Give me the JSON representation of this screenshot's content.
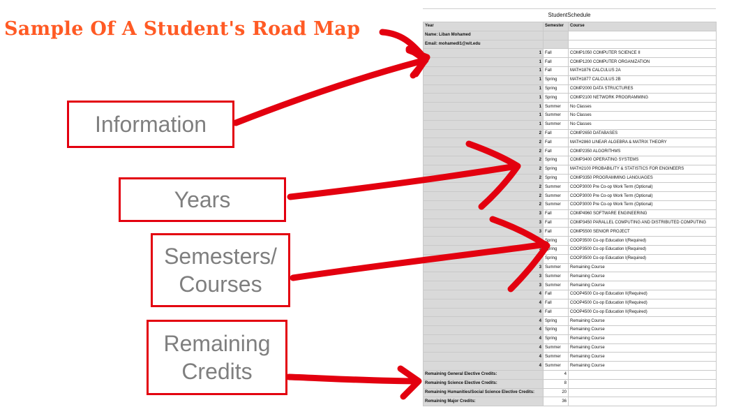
{
  "title": "Sample Of A Student's Road Map",
  "callouts": {
    "info": "Information",
    "years": "Years",
    "semesters": "Semesters/\nCourses",
    "remaining": "Remaining\nCredits"
  },
  "sheet": {
    "title": "StudentSchedule",
    "headers": [
      "Year",
      "Semester",
      "Course"
    ],
    "info": [
      {
        "label": "Name: Liban Mohamed"
      },
      {
        "label": "Email: mohamedl1@wit.edu"
      }
    ],
    "rows": [
      {
        "year": "1",
        "semester": "Fall",
        "course": "COMP1050   COMPUTER SCIENCE II"
      },
      {
        "year": "1",
        "semester": "Fall",
        "course": "COMP1200   COMPUTER ORGANIZATION"
      },
      {
        "year": "1",
        "semester": "Fall",
        "course": "MATH1876   CALCULUS 2A"
      },
      {
        "year": "1",
        "semester": "Spring",
        "course": "MATH1877   CALCULUS 2B"
      },
      {
        "year": "1",
        "semester": "Spring",
        "course": "COMP2000   DATA STRUCTURES"
      },
      {
        "year": "1",
        "semester": "Spring",
        "course": "COMP2100   NETWORK PROGRAMMING"
      },
      {
        "year": "1",
        "semester": "Summer",
        "course": "No Classes"
      },
      {
        "year": "1",
        "semester": "Summer",
        "course": "No Classes"
      },
      {
        "year": "1",
        "semester": "Summer",
        "course": "No Classes"
      },
      {
        "year": "2",
        "semester": "Fall",
        "course": "COMP2650   DATABASES"
      },
      {
        "year": "2",
        "semester": "Fall",
        "course": "MATH2860   LINEAR ALGEBRA & MATRIX THEORY"
      },
      {
        "year": "2",
        "semester": "Fall",
        "course": "COMP2350   ALGORITHMS"
      },
      {
        "year": "2",
        "semester": "Spring",
        "course": "COMP3400   OPERATING SYSTEMS"
      },
      {
        "year": "2",
        "semester": "Spring",
        "course": "MATH2100   PROBABILITY & STATISTICS FOR ENGINEERS"
      },
      {
        "year": "2",
        "semester": "Spring",
        "course": "COMP3350   PROGRAMMING LANGUAGES"
      },
      {
        "year": "2",
        "semester": "Summer",
        "course": "COOP3000 Pre Co-op Work Term (Optional)"
      },
      {
        "year": "2",
        "semester": "Summer",
        "course": "COOP3000 Pre Co-op Work Term (Optional)"
      },
      {
        "year": "2",
        "semester": "Summer",
        "course": "COOP3000 Pre Co-op Work Term (Optional)"
      },
      {
        "year": "3",
        "semester": "Fall",
        "course": "COMP4960   SOFTWARE ENGINEERING"
      },
      {
        "year": "3",
        "semester": "Fall",
        "course": "COMP3450   PARALLEL COMPUTING AND DISTRIBUTED COMPUTING"
      },
      {
        "year": "3",
        "semester": "Fall",
        "course": "COMP5500   SENIOR PROJECT"
      },
      {
        "year": "3",
        "semester": "Spring",
        "course": "COOP3500 Co-op Education I(Required)"
      },
      {
        "year": "3",
        "semester": "Spring",
        "course": "COOP3500 Co-op Education I(Required)"
      },
      {
        "year": "3",
        "semester": "Spring",
        "course": "COOP3500 Co-op Education I(Required)"
      },
      {
        "year": "3",
        "semester": "Summer",
        "course": "Remaining Course"
      },
      {
        "year": "3",
        "semester": "Summer",
        "course": "Remaining Course"
      },
      {
        "year": "3",
        "semester": "Summer",
        "course": "Remaining Course"
      },
      {
        "year": "4",
        "semester": "Fall",
        "course": "COOP4500 Co-op Education II(Required)"
      },
      {
        "year": "4",
        "semester": "Fall",
        "course": "COOP4500 Co-op Education II(Required)"
      },
      {
        "year": "4",
        "semester": "Fall",
        "course": "COOP4500 Co-op Education II(Required)"
      },
      {
        "year": "4",
        "semester": "Spring",
        "course": "Remaining Course"
      },
      {
        "year": "4",
        "semester": "Spring",
        "course": "Remaining Course"
      },
      {
        "year": "4",
        "semester": "Spring",
        "course": "Remaining Course"
      },
      {
        "year": "4",
        "semester": "Summer",
        "course": "Remaining Course"
      },
      {
        "year": "4",
        "semester": "Summer",
        "course": "Remaining Course"
      },
      {
        "year": "4",
        "semester": "Summer",
        "course": "Remaining Course"
      }
    ],
    "credits": [
      {
        "label": "Remaining General Elective Credits:",
        "value": "4"
      },
      {
        "label": "Remaining Science Elective Credits:",
        "value": "8"
      },
      {
        "label": "Remaining Humanities/Social Science Elective Credits:",
        "value": "20"
      },
      {
        "label": "Remaining Major Credits:",
        "value": "36"
      }
    ]
  },
  "colors": {
    "title": "#ff5a24",
    "callout_border": "#e3000f",
    "arrow": "#e3000f",
    "cell_gray": "#d9d9d9"
  }
}
